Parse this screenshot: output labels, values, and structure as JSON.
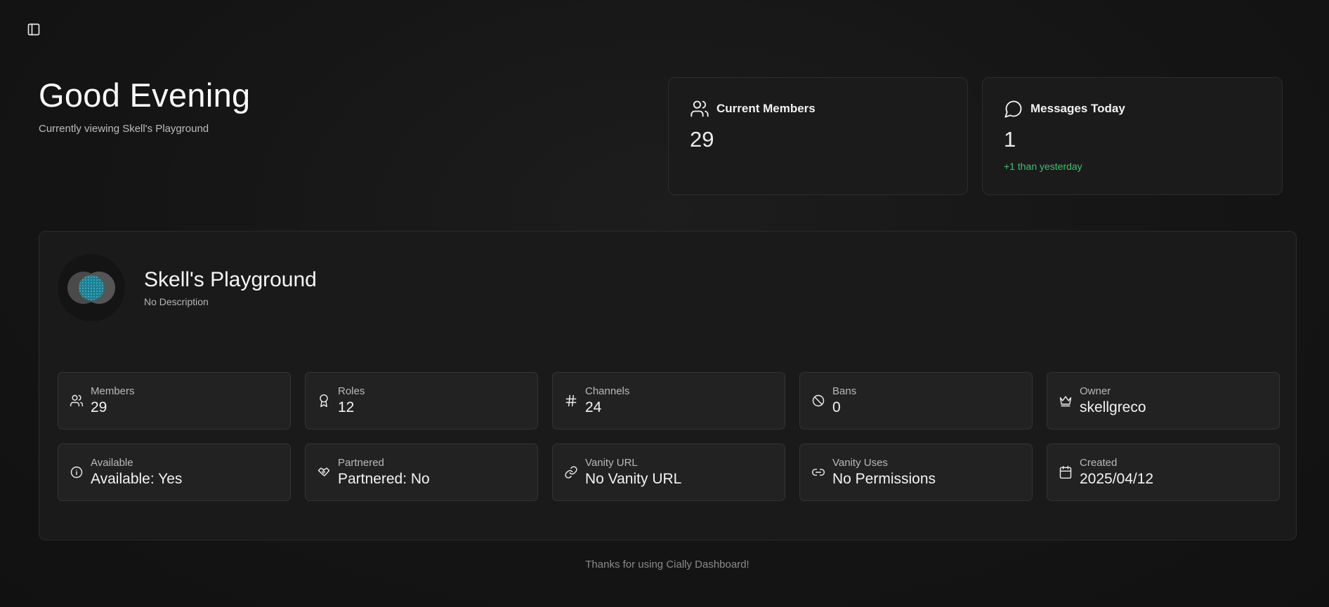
{
  "icons": {
    "sidebar_toggle": "sidebar-panel-icon",
    "members": "users-icon",
    "messages": "message-circle-icon"
  },
  "header": {
    "greeting": "Good Evening",
    "subtitle": "Currently viewing Skell's Playground"
  },
  "stats": {
    "members": {
      "title": "Current Members",
      "value": "29"
    },
    "messages": {
      "title": "Messages Today",
      "value": "1",
      "delta": "+1 than yesterday"
    }
  },
  "server": {
    "name": "Skell's Playground",
    "description": "No Description"
  },
  "tiles": [
    {
      "label": "Members",
      "value": "29",
      "icon": "users-icon"
    },
    {
      "label": "Roles",
      "value": "12",
      "icon": "award-icon"
    },
    {
      "label": "Channels",
      "value": "24",
      "icon": "hash-icon"
    },
    {
      "label": "Bans",
      "value": "0",
      "icon": "ban-icon"
    },
    {
      "label": "Owner",
      "value": "skellgreco",
      "icon": "crown-icon"
    },
    {
      "label": "Available",
      "value": "Available: Yes",
      "icon": "info-icon"
    },
    {
      "label": "Partnered",
      "value": "Partnered: No",
      "icon": "handshake-icon"
    },
    {
      "label": "Vanity URL",
      "value": "No Vanity URL",
      "icon": "link-icon"
    },
    {
      "label": "Vanity Uses",
      "value": "No Permissions",
      "icon": "link-2-icon"
    },
    {
      "label": "Created",
      "value": "2025/04/12",
      "icon": "calendar-icon"
    }
  ],
  "footer": {
    "text": "Thanks for using Cially Dashboard!"
  },
  "colors": {
    "accent_positive": "#3ec46d",
    "background": "#151515"
  }
}
